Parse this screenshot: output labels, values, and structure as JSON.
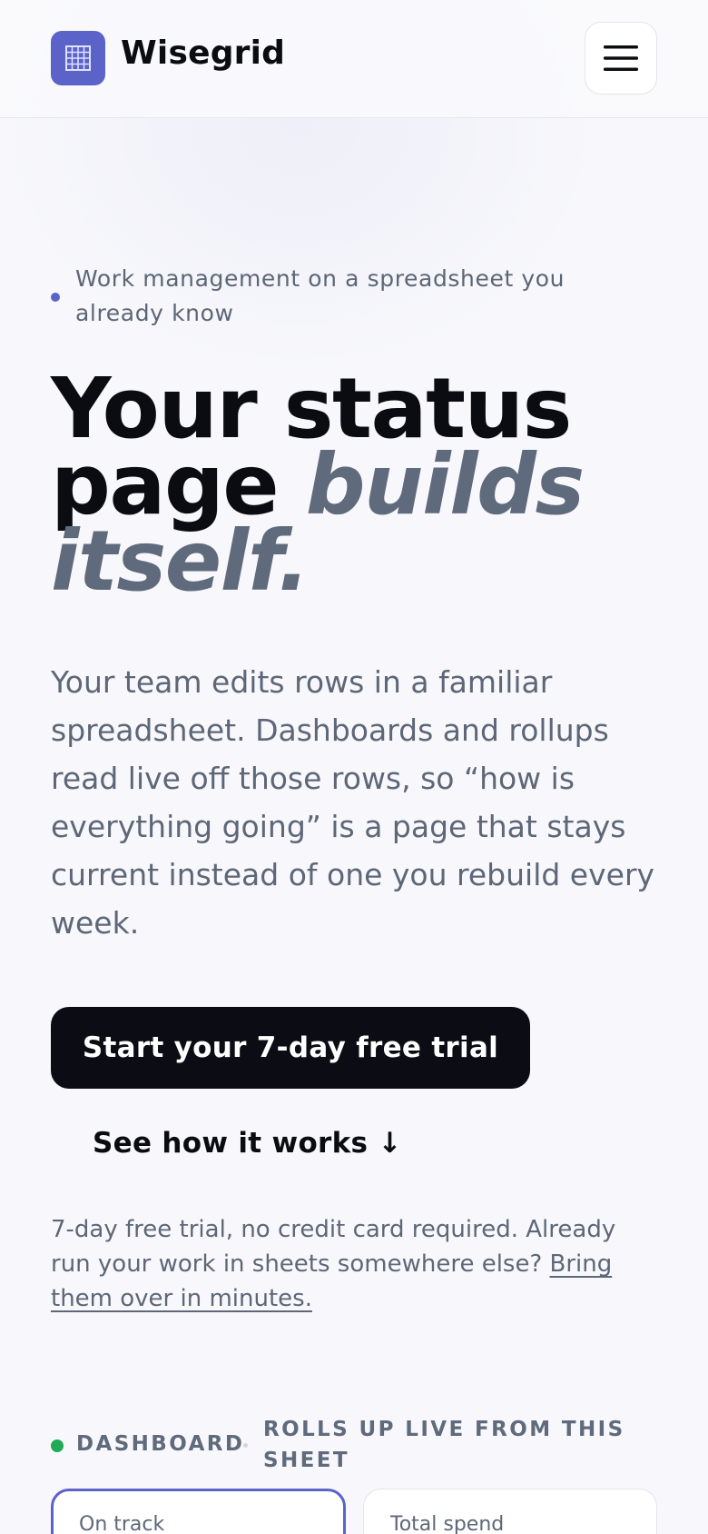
{
  "header": {
    "brand": "Wisegrid",
    "logo_icon": "grid-icon",
    "menu_icon": "hamburger-menu-icon",
    "accent_color": "#5b63c9"
  },
  "hero": {
    "eyebrow": "Work management on a spreadsheet you already know",
    "title_line1": "Your status",
    "title_line2_plain": "page ",
    "title_accent": "builds itself.",
    "lead": "Your team edits rows in a familiar spreadsheet. Dashboards and rollups read live off those rows, so “how is everything going” is a page that stays current instead of one you rebuild every week.",
    "cta_primary": "Start your 7-day free trial",
    "cta_secondary": "See how it works ↓",
    "fine_print": "7-day free trial, no credit card required. Already run your work in sheets somewhere else? ",
    "fine_link": "Bring them over in minutes."
  },
  "dashboard": {
    "label": "DASHBOARD",
    "rollup": "ROLLS UP LIVE FROM THIS SHEET",
    "live_color": "#1faa55",
    "cards": [
      {
        "label": "On track"
      },
      {
        "label": "Total spend"
      }
    ]
  }
}
